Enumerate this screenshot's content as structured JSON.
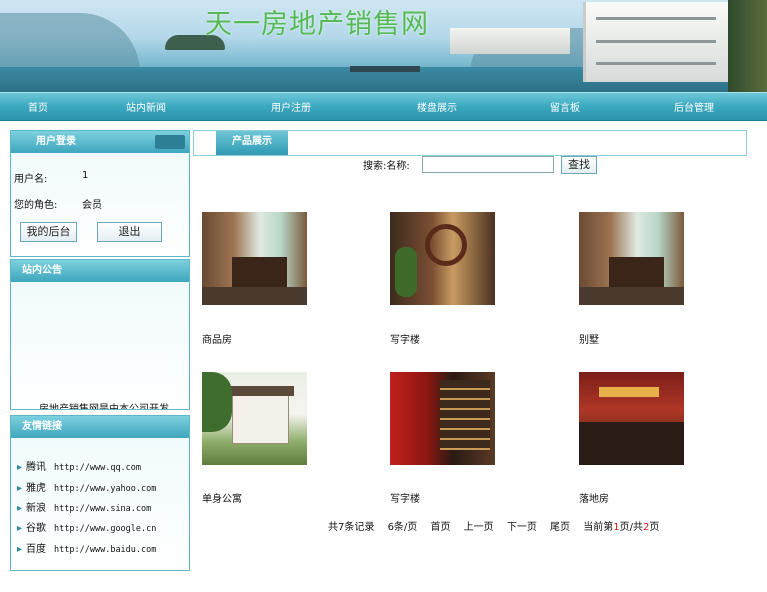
{
  "site": {
    "title": "天一房地产销售网"
  },
  "nav": {
    "items": [
      "首页",
      "站内新闻",
      "用户注册",
      "楼盘展示",
      "留言板",
      "后台管理"
    ]
  },
  "login": {
    "header": "用户登录",
    "username_label": "用户名:",
    "username_value": "1",
    "role_label": "您的角色:",
    "role_value": "会员",
    "my_backend_btn": "我的后台",
    "logout_btn": "退出"
  },
  "notice": {
    "header": "站内公告",
    "marquee_text": "房地产销售网是由本公司开发"
  },
  "links": {
    "header": "友情链接",
    "items": [
      {
        "name": "腾讯",
        "url": "http://www.qq.com"
      },
      {
        "name": "雅虎",
        "url": "http://www.yahoo.com"
      },
      {
        "name": "新浪",
        "url": "http://www.sina.com"
      },
      {
        "name": "谷歌",
        "url": "http://www.google.cn"
      },
      {
        "name": "百度",
        "url": "http://www.baidu.com"
      }
    ]
  },
  "products": {
    "header": "产品展示",
    "search_label": "搜索:名称:",
    "search_value": "",
    "search_btn": "查找",
    "items": [
      {
        "name": "商品房",
        "image": "tea-room-interior"
      },
      {
        "name": "写字楼",
        "image": "carved-screen-office"
      },
      {
        "name": "别墅",
        "image": "tea-room-interior"
      },
      {
        "name": "单身公寓",
        "image": "courtyard-house"
      },
      {
        "name": "写字楼",
        "image": "wine-shelf-office"
      },
      {
        "name": "落地房",
        "image": "restaurant-hall"
      }
    ]
  },
  "pager": {
    "total": "共7条记录",
    "per_page": "6条/页",
    "first": "首页",
    "prev": "上一页",
    "next": "下一页",
    "last": "尾页",
    "current_prefix": "当前第",
    "current_page": "1",
    "current_mid": "页/共",
    "total_pages": "2",
    "current_suffix": "页"
  }
}
